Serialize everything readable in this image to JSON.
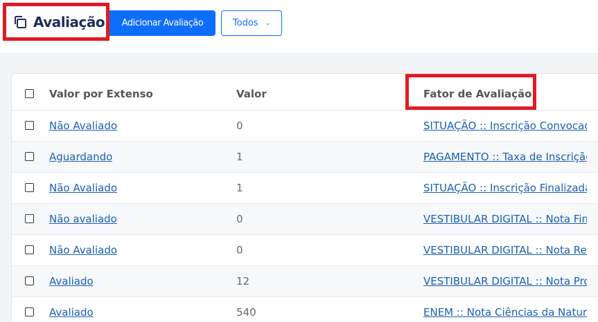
{
  "header": {
    "title": "Avaliação",
    "add_button": "Adicionar Avaliação",
    "filter_button": "Todos"
  },
  "colors": {
    "primary": "#0d6efd",
    "highlight": "#e21a22",
    "link": "#1a5fb4",
    "title": "#1f2d5a"
  },
  "table": {
    "columns": [
      "Valor por Extenso",
      "Valor",
      "Fator de Avaliação"
    ],
    "rows": [
      {
        "extenso": "Não Avaliado",
        "valor": "0",
        "fator": "SITUAÇÃO :: Inscrição Convocada"
      },
      {
        "extenso": "Aguardando",
        "valor": "1",
        "fator": "PAGAMENTO :: Taxa de Inscrição"
      },
      {
        "extenso": "Não Avaliado",
        "valor": "1",
        "fator": "SITUAÇÃO :: Inscrição Finalizada"
      },
      {
        "extenso": "Não avaliado",
        "valor": "0",
        "fator": "VESTIBULAR DIGITAL :: Nota Final"
      },
      {
        "extenso": "Não Avaliado",
        "valor": "0",
        "fator": "VESTIBULAR DIGITAL :: Nota Redação"
      },
      {
        "extenso": "Avaliado",
        "valor": "12",
        "fator": "VESTIBULAR DIGITAL :: Nota Prova"
      },
      {
        "extenso": "Avaliado",
        "valor": "540",
        "fator": "ENEM :: Nota Ciências da Natureza"
      }
    ]
  }
}
